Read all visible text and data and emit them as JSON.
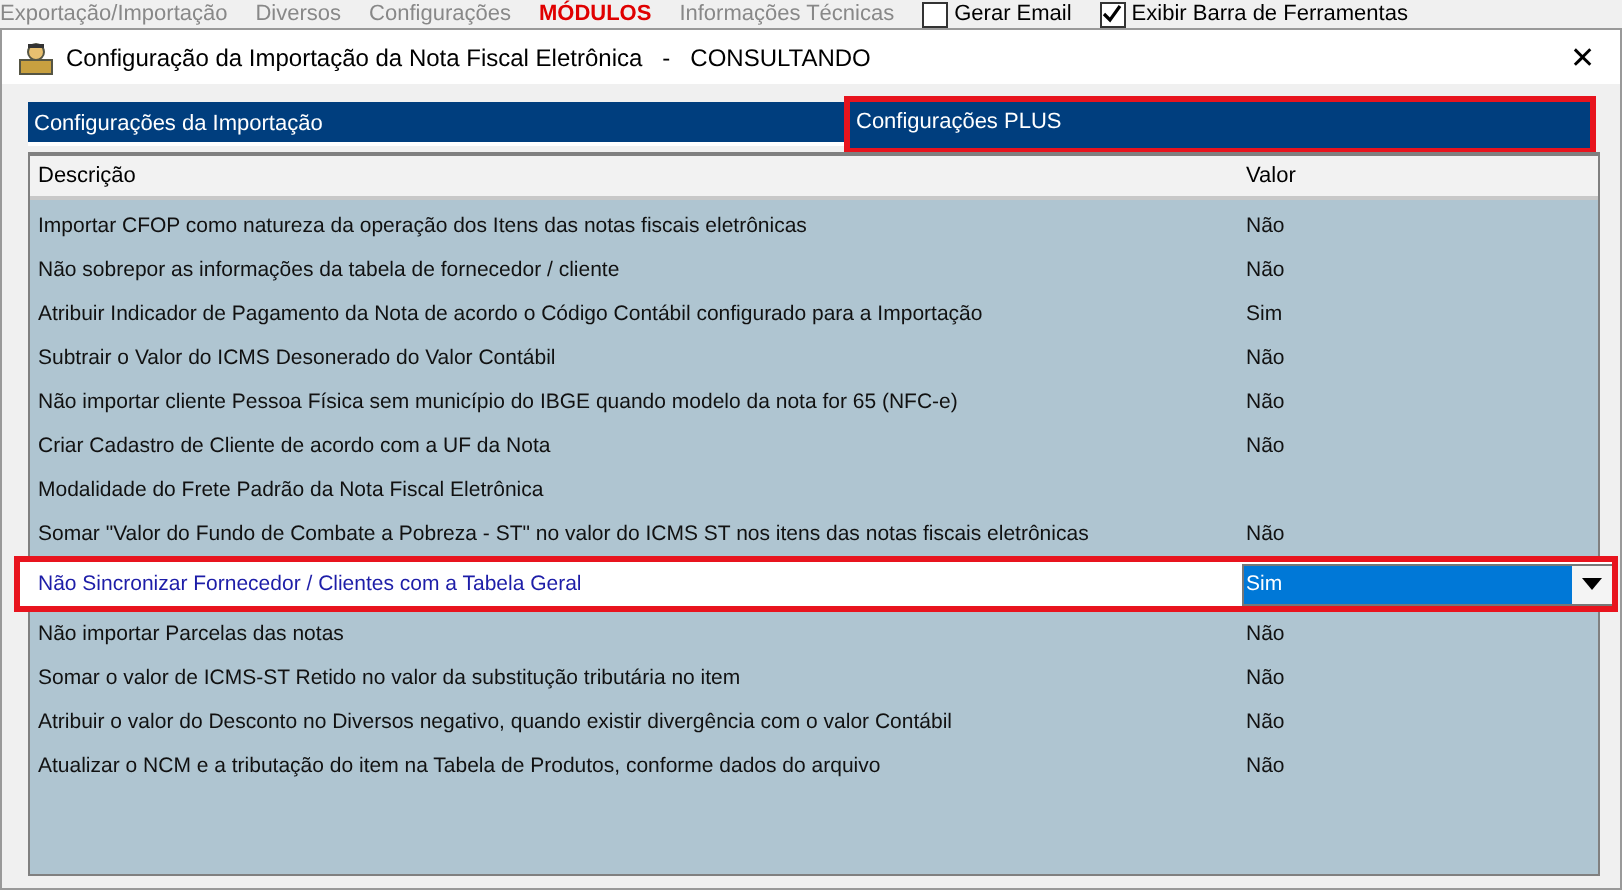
{
  "menu_bar": {
    "items": [
      {
        "label": "Exportação/Importação",
        "highlighted": false
      },
      {
        "label": "Diversos",
        "highlighted": false
      },
      {
        "label": "Configurações",
        "highlighted": false
      },
      {
        "label": "MÓDULOS",
        "highlighted": true
      },
      {
        "label": "Informações Técnicas",
        "highlighted": false
      }
    ],
    "checkboxes": [
      {
        "label": "Gerar Email",
        "checked": false
      },
      {
        "label": "Exibir Barra de Ferramentas",
        "checked": true
      }
    ]
  },
  "window": {
    "title": "Configuração da Importação da Nota Fiscal Eletrônica   -   CONSULTANDO",
    "close": "✕"
  },
  "tabs": [
    {
      "label": "Configurações da Importação",
      "selected": true,
      "highlighted": false
    },
    {
      "label": "Configurações PLUS",
      "selected": false,
      "highlighted": true
    }
  ],
  "table": {
    "columns": [
      "Descrição",
      "Valor"
    ],
    "rows": [
      {
        "description": "Importar CFOP como natureza da operação dos Itens das notas fiscais eletrônicas",
        "value": "Não",
        "selected": false
      },
      {
        "description": "Não sobrepor as informações da tabela de fornecedor / cliente",
        "value": "Não",
        "selected": false
      },
      {
        "description": "Atribuir Indicador de Pagamento da Nota de acordo o Código Contábil configurado para a Importação",
        "value": "Sim",
        "selected": false
      },
      {
        "description": "Subtrair o Valor do ICMS Desonerado do Valor Contábil",
        "value": "Não",
        "selected": false
      },
      {
        "description": "Não importar cliente Pessoa Física sem município do IBGE quando modelo da nota for 65 (NFC-e)",
        "value": "Não",
        "selected": false
      },
      {
        "description": "Criar Cadastro de Cliente de acordo com a UF da Nota",
        "value": "Não",
        "selected": false
      },
      {
        "description": "Modalidade do Frete Padrão da Nota Fiscal Eletrônica",
        "selected": false
      },
      {
        "description": "Somar \"Valor do Fundo de Combate a Pobreza - ST\" no valor do ICMS ST nos itens das notas fiscais eletrônicas",
        "value": "Não",
        "selected": false
      },
      {
        "description": "Não Sincronizar Fornecedor / Clientes com a Tabela Geral",
        "value": "Sim",
        "selected": true
      },
      {
        "description": "Não importar Parcelas das notas",
        "value": "Não",
        "selected": false
      },
      {
        "description": "Somar o valor de ICMS-ST Retido no valor da substitução tributária no item",
        "value": "Não",
        "selected": false
      },
      {
        "description": "Atribuir o valor do Desconto no Diversos negativo, quando existir divergência com o valor Contábil",
        "value": "Não",
        "selected": false
      },
      {
        "description": "Atualizar o NCM e a tributação do item na Tabela de Produtos, conforme dados do arquivo",
        "value": "Não",
        "selected": false
      }
    ]
  }
}
